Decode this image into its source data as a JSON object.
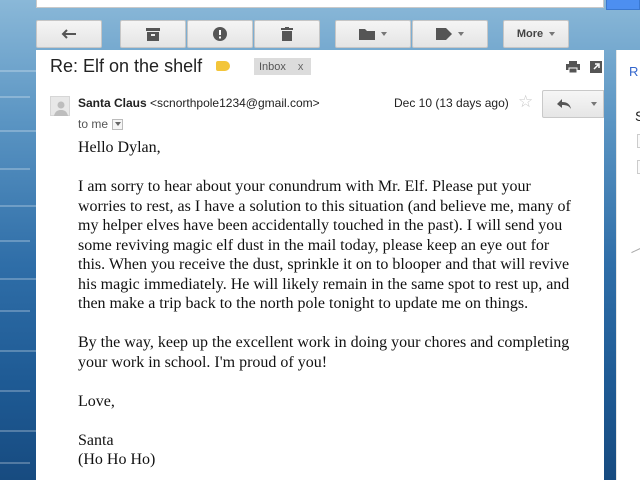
{
  "toolbar": {
    "more_label": "More"
  },
  "email": {
    "subject": "Re: Elf on the shelf",
    "label_chip": "Inbox",
    "label_chip_close": "x",
    "sender_name": "Santa Claus",
    "sender_email": "<scnorthpole1234@gmail.com>",
    "date": "Dec 10 (13 days ago)",
    "to": "to me",
    "body": [
      "Hello Dylan,",
      "I am sorry to hear about your conundrum with Mr. Elf. Please put your worries to rest, as I have a solution to this situation (and believe me, many of my helper elves have been accidentally touched in the past). I will send you some reviving magic elf dust in the mail today, please keep an eye out for this. When you receive the dust, sprinkle it on to blooper and that will revive his magic immediately. He will likely remain in the same spot to rest up, and then make a trip back to the north pole tonight to update me on things.",
      "By the way, keep up the excellent work in doing your chores and completing your work in school. I'm proud of you!",
      "Love,",
      "Santa\n(Ho Ho Ho)"
    ]
  },
  "side_panel": {
    "top_letter": "R",
    "mid_letter": "S"
  },
  "colors": {
    "label_tag": "#f3c53a",
    "link_blue": "#3466cc",
    "search_button": "#4d8ff0"
  }
}
